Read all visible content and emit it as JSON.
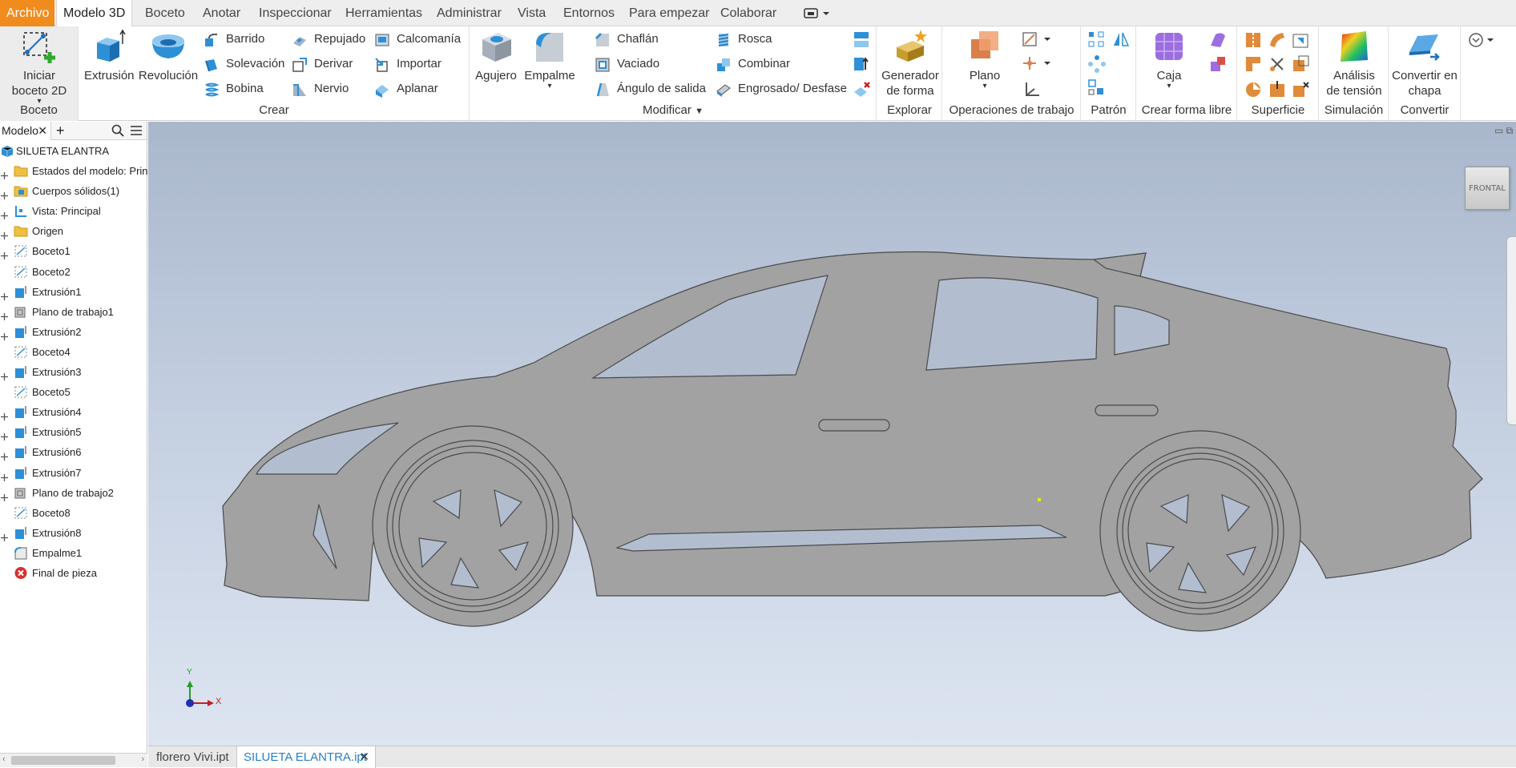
{
  "menu": {
    "tabs": [
      "Archivo",
      "Modelo 3D",
      "Boceto",
      "Anotar",
      "Inspeccionar",
      "Herramientas",
      "Administrar",
      "Vista",
      "Entornos",
      "Para empezar",
      "Colaborar"
    ]
  },
  "ribbon": {
    "boceto": {
      "label": "Boceto",
      "start_sketch_l1": "Iniciar",
      "start_sketch_l2": "boceto 2D"
    },
    "crear": {
      "label": "Crear",
      "extrusion": "Extrusión",
      "revolucion": "Revolución",
      "barrido": "Barrido",
      "solevacion": "Solevación",
      "bobina": "Bobina",
      "repujado": "Repujado",
      "derivar": "Derivar",
      "nervio": "Nervio",
      "calcomania": "Calcomanía",
      "importar": "Importar",
      "aplanar": "Aplanar"
    },
    "modificar": {
      "label": "Modificar",
      "agujero": "Agujero",
      "empalme": "Empalme",
      "chaflan": "Chaflán",
      "vaciado": "Vaciado",
      "angulo": "Ángulo de salida",
      "rosca": "Rosca",
      "combinar": "Combinar",
      "engrosado": "Engrosado/ Desfase"
    },
    "explorar": {
      "label": "Explorar",
      "generador_l1": "Generador",
      "generador_l2": "de forma"
    },
    "operaciones": {
      "label": "Operaciones de trabajo",
      "plano": "Plano"
    },
    "patron": {
      "label": "Patrón"
    },
    "forma_libre": {
      "label": "Crear forma libre",
      "caja": "Caja"
    },
    "superficie": {
      "label": "Superficie"
    },
    "simulacion": {
      "label": "Simulación",
      "analisis_l1": "Análisis",
      "analisis_l2": "de tensión"
    },
    "convertir": {
      "label": "Convertir",
      "chapa_l1": "Convertir en",
      "chapa_l2": "chapa"
    }
  },
  "browser": {
    "tab_label": "Modelo",
    "root": "SILUETA ELANTRA",
    "items": [
      "Estados del modelo: Principal",
      "Cuerpos sólidos(1)",
      "Vista: Principal",
      "Origen",
      "Boceto1",
      "Boceto2",
      "Extrusión1",
      "Plano de trabajo1",
      "Extrusión2",
      "Boceto4",
      "Extrusión3",
      "Boceto5",
      "Extrusión4",
      "Extrusión5",
      "Extrusión6",
      "Extrusión7",
      "Plano de trabajo2",
      "Boceto8",
      "Extrusión8",
      "Empalme1",
      "Final de pieza"
    ]
  },
  "viewport": {
    "viewcube_face": "FRONTAL",
    "axis_x": "X",
    "axis_y": "Y"
  },
  "documents": [
    "florero Vivi.ipt",
    "SILUETA ELANTRA.ipt"
  ],
  "colors": {
    "file_tab": "#f08c1e",
    "accent_blue": "#2a7fc4",
    "part_gray": "#a2a2a2"
  }
}
